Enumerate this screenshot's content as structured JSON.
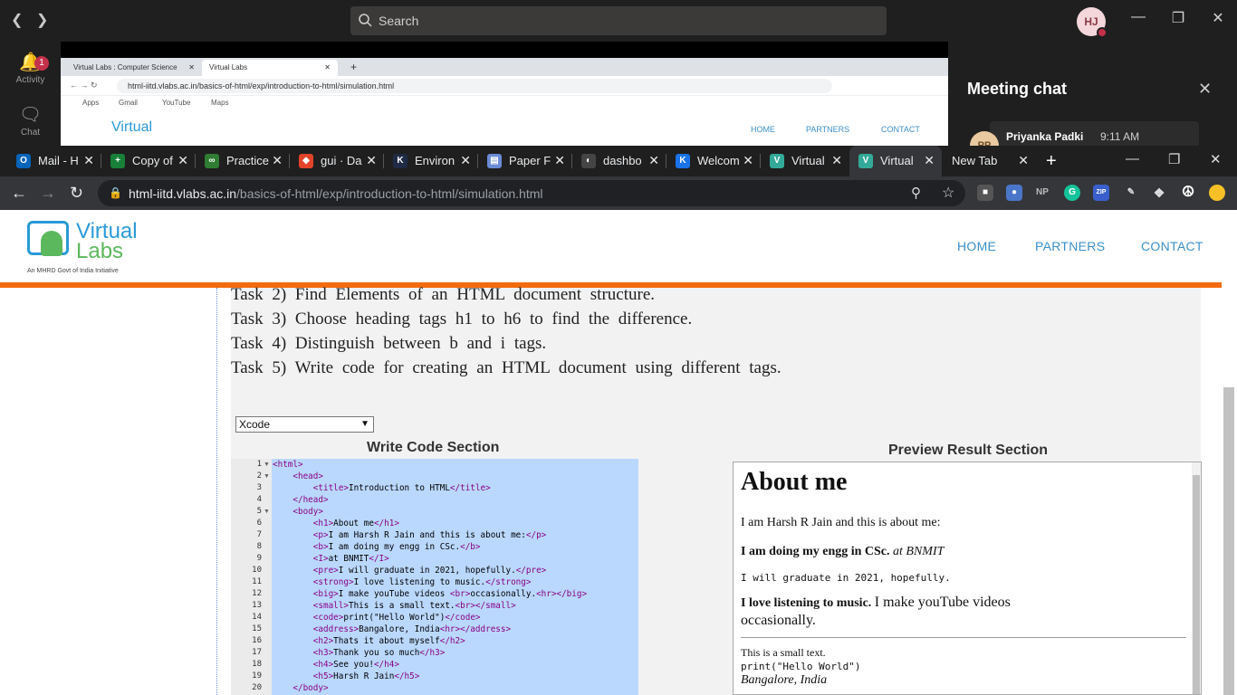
{
  "teams": {
    "search_placeholder": "Search",
    "avatar_initials": "HJ",
    "rail": [
      {
        "label": "Activity",
        "badge": "1"
      },
      {
        "label": "Chat"
      }
    ]
  },
  "shared_screen": {
    "tabs": [
      "Virtual Labs : Computer Science",
      "Virtual Labs"
    ],
    "url": "html-iitd.vlabs.ac.in/basics-of-html/exp/introduction-to-html/simulation.html",
    "bookmarks": [
      "Apps",
      "Gmail",
      "YouTube",
      "Maps"
    ],
    "nav": [
      "HOME",
      "PARTNERS",
      "CONTACT"
    ],
    "logo_text": "Virtual Labs"
  },
  "chat": {
    "title": "Meeting chat",
    "sender": "Priyanka Padki",
    "time": "9:11 AM",
    "sender_initials": "PP"
  },
  "browser": {
    "tabs": [
      {
        "label": "Mail - H",
        "color": "#0364b8",
        "glyph": "O"
      },
      {
        "label": "Copy of",
        "color": "#188038",
        "glyph": "+"
      },
      {
        "label": "Practice",
        "color": "#2e7d32",
        "glyph": "∞"
      },
      {
        "label": "gui · Da",
        "color": "#e24329",
        "glyph": "◆"
      },
      {
        "label": "Environ",
        "color": "#1f2a44",
        "glyph": "K"
      },
      {
        "label": "Paper F",
        "color": "#6b8bd6",
        "glyph": "▤"
      },
      {
        "label": "dashbo",
        "color": "#444",
        "glyph": "◐"
      },
      {
        "label": "Welcom",
        "color": "#1a73e8",
        "glyph": "K"
      },
      {
        "label": "Virtual",
        "color": "#3a9",
        "glyph": "V"
      },
      {
        "label": "Virtual",
        "color": "#3a9",
        "glyph": "V"
      },
      {
        "label": "New Tab",
        "color": "",
        "glyph": ""
      }
    ],
    "url_host": "html-iitd.vlabs.ac.in",
    "url_path": "/basics-of-html/exp/introduction-to-html/simulation.html",
    "extensions": [
      "NP",
      "G",
      "ZIP"
    ]
  },
  "site": {
    "logo": {
      "line1": "Virtual",
      "line2": "Labs",
      "tagline": "An MHRD Govt of India Initiative"
    },
    "nav": [
      "HOME",
      "PARTNERS",
      "CONTACT"
    ],
    "tasks": [
      "Task 2) Find Elements of an HTML document structure.",
      "Task 3) Choose heading tags h1 to h6 to find the difference.",
      "Task 4) Distinguish between b and i tags.",
      "Task 5) Write code for creating an HTML document using different tags."
    ],
    "select_value": "Xcode",
    "write_title": "Write Code Section",
    "preview_title": "Preview Result Section",
    "code_lines": [
      {
        "n": "1",
        "t": "<html>"
      },
      {
        "n": "2",
        "t": "    <head>"
      },
      {
        "n": "3",
        "t": "        <title>Introduction to HTML</title>"
      },
      {
        "n": "4",
        "t": "    </head>"
      },
      {
        "n": "5",
        "t": "    <body>"
      },
      {
        "n": "6",
        "t": "        <h1>About me</h1>"
      },
      {
        "n": "7",
        "t": "        <p>I am Harsh R Jain and this is about me:</p>"
      },
      {
        "n": "8",
        "t": "        <b>I am doing my engg in CSc.</b>"
      },
      {
        "n": "9",
        "t": "        <I>at BNMIT</I>"
      },
      {
        "n": "10",
        "t": "        <pre>I will graduate in 2021, hopefully.</pre>"
      },
      {
        "n": "11",
        "t": "        <strong>I love listening to music.</strong>"
      },
      {
        "n": "12",
        "t": "        <big>I make youTube videos <br>occasionally.<hr></big>"
      },
      {
        "n": "13",
        "t": "        <small>This is a small text.<br></small>"
      },
      {
        "n": "14",
        "t": "        <code>print(\"Hello World\")</code>"
      },
      {
        "n": "15",
        "t": "        <address>Bangalore, India<hr></address>"
      },
      {
        "n": "16",
        "t": "        <h2>Thats it about myself</h2>"
      },
      {
        "n": "17",
        "t": "        <h3>Thank you so much</h3>"
      },
      {
        "n": "18",
        "t": "        <h4>See you!</h4>"
      },
      {
        "n": "19",
        "t": "        <h5>Harsh R Jain</h5>"
      },
      {
        "n": "20",
        "t": "    </body>"
      }
    ],
    "preview": {
      "h1": "About me",
      "p": "I am Harsh R Jain and this is about me:",
      "b": "I am doing my engg in CSc.",
      "i": "at BNMIT",
      "pre": "I will graduate in 2021, hopefully.",
      "strong": "I love listening to music.",
      "big1": "I make youTube videos",
      "big2": "occasionally.",
      "small": "This is a small text.",
      "code": "print(\"Hello World\")",
      "address": "Bangalore, India"
    }
  }
}
